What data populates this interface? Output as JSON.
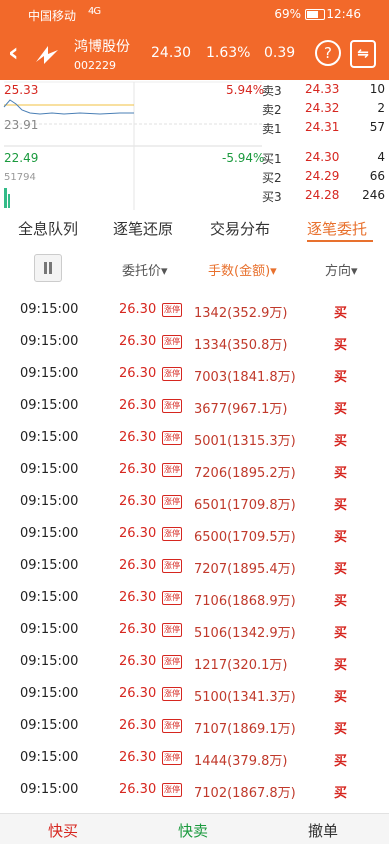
{
  "status": {
    "carrier": "中国移动",
    "signal": "4G",
    "battery": "69%",
    "time": "12:46"
  },
  "header": {
    "name": "鸿博股份",
    "code": "002229",
    "price": "24.30",
    "pct": "1.63%",
    "change": "0.39",
    "help_icon": "?",
    "compare_icon": "⇋"
  },
  "chart": {
    "high": "25.33",
    "mid": "23.91",
    "low": "22.49",
    "high_pct": "5.94%",
    "low_pct": "-5.94%",
    "vol": "51794"
  },
  "orderbook": [
    {
      "label": "卖3",
      "price": "24.33",
      "vol": "10",
      "color": "red"
    },
    {
      "label": "卖2",
      "price": "24.32",
      "vol": "2",
      "color": "red"
    },
    {
      "label": "卖1",
      "price": "24.31",
      "vol": "57",
      "color": "red"
    },
    {
      "label": "买1",
      "price": "24.30",
      "vol": "4",
      "color": "red"
    },
    {
      "label": "买2",
      "price": "24.29",
      "vol": "66",
      "color": "red"
    },
    {
      "label": "买3",
      "price": "24.28",
      "vol": "246",
      "color": "red"
    }
  ],
  "tabs": [
    "全息队列",
    "逐笔还原",
    "交易分布",
    "逐笔委托"
  ],
  "columns": {
    "price": "委托价▾",
    "qty": "手数(金额)▾",
    "dir": "方向▾"
  },
  "badge": "涨停",
  "rows": [
    {
      "time": "09:15:00",
      "price": "26.30",
      "qty": "1342(352.9万)",
      "dir": "买"
    },
    {
      "time": "09:15:00",
      "price": "26.30",
      "qty": "1334(350.8万)",
      "dir": "买"
    },
    {
      "time": "09:15:00",
      "price": "26.30",
      "qty": "7003(1841.8万)",
      "dir": "买"
    },
    {
      "time": "09:15:00",
      "price": "26.30",
      "qty": "3677(967.1万)",
      "dir": "买"
    },
    {
      "time": "09:15:00",
      "price": "26.30",
      "qty": "5001(1315.3万)",
      "dir": "买"
    },
    {
      "time": "09:15:00",
      "price": "26.30",
      "qty": "7206(1895.2万)",
      "dir": "买"
    },
    {
      "time": "09:15:00",
      "price": "26.30",
      "qty": "6501(1709.8万)",
      "dir": "买"
    },
    {
      "time": "09:15:00",
      "price": "26.30",
      "qty": "6500(1709.5万)",
      "dir": "买"
    },
    {
      "time": "09:15:00",
      "price": "26.30",
      "qty": "7207(1895.4万)",
      "dir": "买"
    },
    {
      "time": "09:15:00",
      "price": "26.30",
      "qty": "7106(1868.9万)",
      "dir": "买"
    },
    {
      "time": "09:15:00",
      "price": "26.30",
      "qty": "5106(1342.9万)",
      "dir": "买"
    },
    {
      "time": "09:15:00",
      "price": "26.30",
      "qty": "1217(320.1万)",
      "dir": "买"
    },
    {
      "time": "09:15:00",
      "price": "26.30",
      "qty": "5100(1341.3万)",
      "dir": "买"
    },
    {
      "time": "09:15:00",
      "price": "26.30",
      "qty": "7107(1869.1万)",
      "dir": "买"
    },
    {
      "time": "09:15:00",
      "price": "26.30",
      "qty": "1444(379.8万)",
      "dir": "买"
    },
    {
      "time": "09:15:00",
      "price": "26.30",
      "qty": "7102(1867.8万)",
      "dir": "买"
    }
  ],
  "bottom": {
    "buy": "快买",
    "sell": "快卖",
    "cancel": "撤单"
  },
  "colors": {
    "accent": "#f2692a",
    "red": "#d6261f",
    "green": "#1b9a3e"
  }
}
